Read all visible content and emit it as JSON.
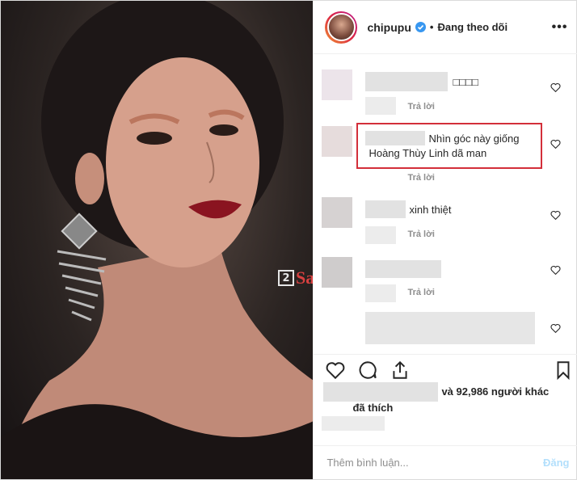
{
  "header": {
    "username": "chipupu",
    "separator": "•",
    "follow_status": "Đang theo dõi",
    "more": "•••"
  },
  "comments": [
    {
      "text": "□□□□",
      "reply": "Trả lời"
    },
    {
      "text_line1": "Nhìn góc này giống",
      "text_line2": "Hoàng Thùy Linh dã man",
      "reply": "Trả lời"
    },
    {
      "text": "xinh thiệt",
      "reply": "Trả lời"
    },
    {
      "text": "",
      "reply": "Trả lời"
    }
  ],
  "likes": {
    "others": "và 92,986 người khác",
    "liked_label": "đã thích"
  },
  "add_comment": {
    "placeholder": "Thêm bình luận...",
    "post": "Đăng"
  },
  "watermark": {
    "number": "2",
    "text": "Sao"
  },
  "colors": {
    "verified": "#3897f0",
    "highlight_border": "#d32f3a",
    "post_disabled": "#b2dffc"
  }
}
